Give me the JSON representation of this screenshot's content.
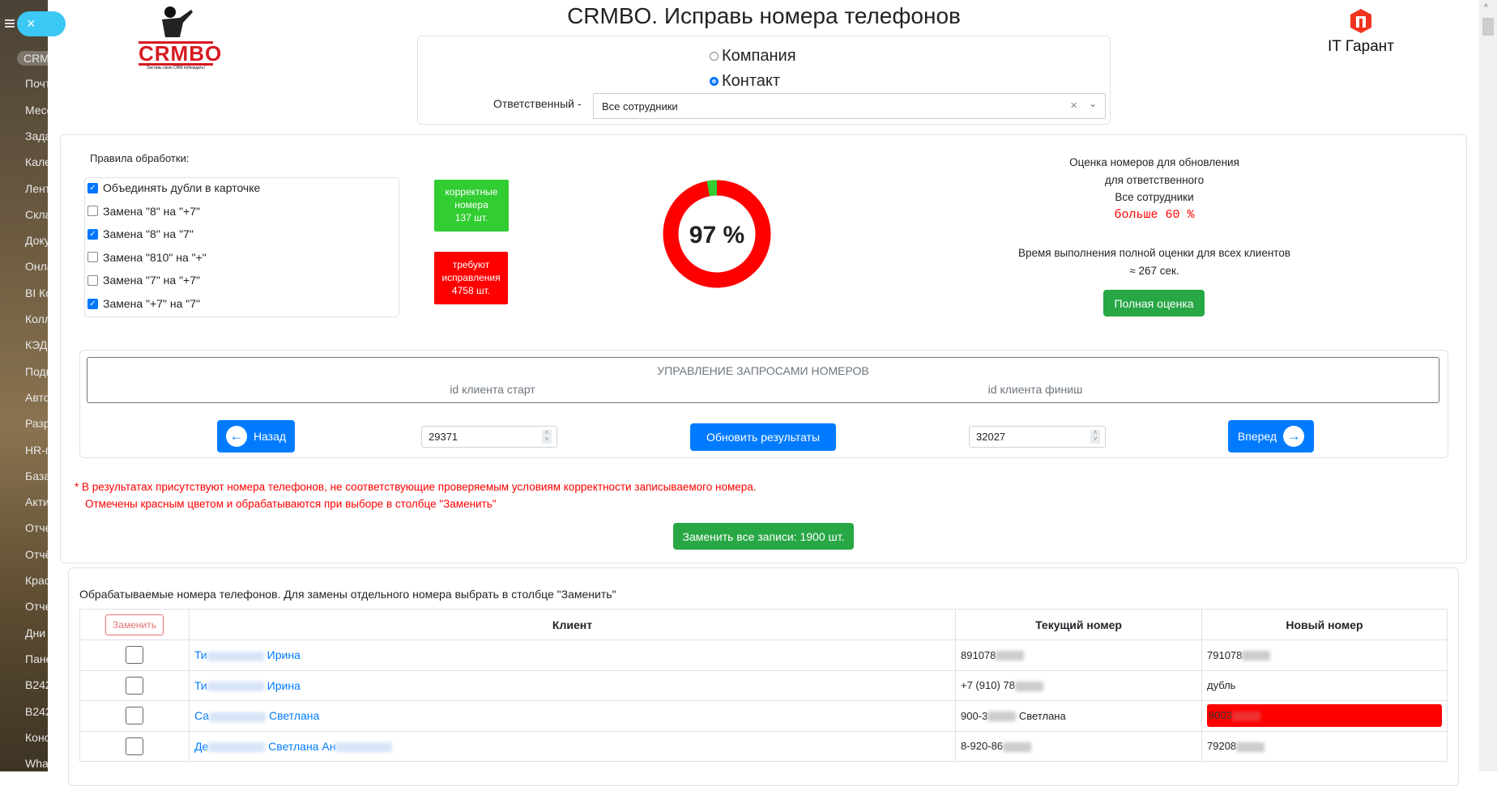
{
  "sidebar": {
    "items": [
      "CRM",
      "Почт",
      "Месс",
      "Зада",
      "Кале",
      "Лент",
      "Скла",
      "Доку",
      "Онла",
      "BI Ко",
      "Колл",
      "КЭДО",
      "Подп",
      "Авто",
      "Разр",
      "HR-п",
      "База",
      "Акти",
      "Отче",
      "Отчё",
      "Крас",
      "Отче",
      "Дни",
      "Пане",
      "B242",
      "B242",
      "Конс",
      "Wha"
    ],
    "close": "×"
  },
  "header": {
    "title": "CRMBO. Исправь номера телефонов",
    "logo_left": "CRMBO",
    "logo_left_tagline": "Заставь свою CRM побеждать!",
    "logo_right": "IT Гарант"
  },
  "entity": {
    "options": [
      "Компания",
      "Контакт"
    ],
    "selected": "Контакт",
    "responsible_label": "Ответственный -",
    "responsible_value": "Все сотрудники"
  },
  "rules": {
    "title": "Правила обработки:",
    "items": [
      {
        "label": "Объединять дубли в карточке",
        "checked": true
      },
      {
        "label": "Замена \"8\" на \"+7\"",
        "checked": false
      },
      {
        "label": "Замена \"8\" на \"7\"",
        "checked": true
      },
      {
        "label": "Замена \"810\" на \"+\"",
        "checked": false
      },
      {
        "label": "Замена \"7\" на \"+7\"",
        "checked": false
      },
      {
        "label": "Замена \"+7\" на \"7\"",
        "checked": true
      }
    ]
  },
  "stats": {
    "correct_l1": "корректные",
    "correct_l2": "номера",
    "correct_count": "137 шт.",
    "fix_l1": "требуют",
    "fix_l2": "исправления",
    "fix_count": "4758 шт.",
    "percent_label": "97 %",
    "percent": 97,
    "colors": {
      "correct": "#32cd32",
      "fix": "#ff0000"
    }
  },
  "assessment": {
    "l1": "Оценка номеров для обновления",
    "l2": "для ответственного",
    "l3": "Все сотрудники",
    "l4": "больше 60 %",
    "l5": "Время выполнения полной оценки для всех клиентов",
    "l6": "≈ 267 сек.",
    "button": "Полная оценка"
  },
  "control": {
    "title": "УПРАВЛЕНИЕ ЗАПРОСАМИ НОМЕРОВ",
    "start_label": "id клиента старт",
    "finish_label": "id клиента финиш",
    "back": "Назад",
    "refresh": "Обновить результаты",
    "forward": "Вперед",
    "start_value": "29371",
    "finish_value": "32027"
  },
  "warning": {
    "l1": "* В результатах присутствуют номера телефонов, не соответствующие проверяемым условиям корректности записываемого номера.",
    "l2": "Отмечены красным цветом и обрабатываются при выборе в столбце \"Заменить\""
  },
  "replace_all": "Заменить все записи: 1900 шт.",
  "table": {
    "caption": "Обрабатываемые номера телефонов. Для замены отдельного номера выбрать в столбце \"Заменить\"",
    "replace_btn": "Заменить",
    "headers": [
      "Клиент",
      "Текущий номер",
      "Новый номер"
    ],
    "rows": [
      {
        "c1": "Ти",
        "c2": "Ирина",
        "c3": "",
        "cur": "891078",
        "cur2": "",
        "new": "791078",
        "red": false
      },
      {
        "c1": "Ти",
        "c2": "Ирина",
        "c3": "",
        "cur": "+7 (910) 78",
        "cur2": "",
        "new": "дубль",
        "red": false
      },
      {
        "c1": "Са",
        "c2": "Светлана",
        "c3": "",
        "cur": "900-3",
        "cur2": "Светлана",
        "new": "9003",
        "red": true
      },
      {
        "c1": "Де",
        "c2": "Светлана Ан",
        "c3": "",
        "cur": "8-920-86",
        "cur2": "",
        "new": "79208",
        "red": false
      }
    ]
  }
}
